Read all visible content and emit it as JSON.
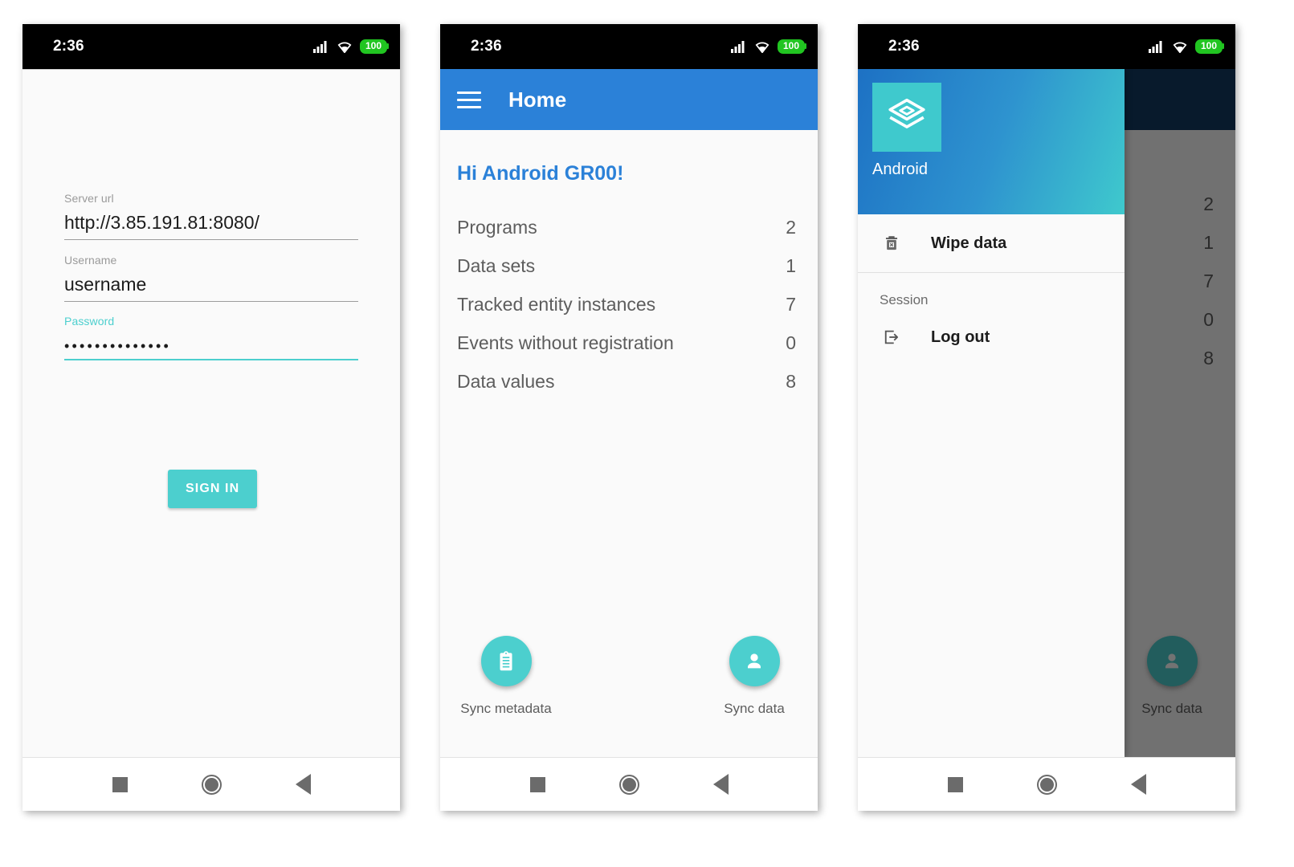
{
  "status_bar": {
    "time": "2:36",
    "battery_level": "100",
    "signal_icon": "cellular-signal-icon",
    "wifi_icon": "wifi-icon",
    "battery_icon": "battery-icon"
  },
  "nav_bar": {
    "recents_icon": "square-recents-icon",
    "home_icon": "circle-home-icon",
    "back_icon": "triangle-back-icon"
  },
  "colors": {
    "accent_teal": "#4ccfce",
    "primary_blue": "#2b81d8",
    "status_bar_black": "#000000",
    "background": "#fafafa",
    "text_secondary": "#5d5d5d",
    "drawer_gradient_start": "#1d71c4",
    "drawer_gradient_end": "#3fc9cd",
    "scrim": "rgba(0,0,0,0.55)",
    "dimmed_fab_teal": "#2a7877"
  },
  "login": {
    "server_url": {
      "label": "Server url",
      "value": "http://3.85.191.81:8080/",
      "focused": false
    },
    "username": {
      "label": "Username",
      "value": "username",
      "focused": false
    },
    "password": {
      "label": "Password",
      "value": "••••••••••••••",
      "focused": true
    },
    "sign_in_label": "SIGN IN"
  },
  "home": {
    "app_bar": {
      "title": "Home",
      "menu_icon": "hamburger-menu-icon"
    },
    "greeting": "Hi Android GR00!",
    "counters": [
      {
        "label": "Programs",
        "value": "2"
      },
      {
        "label": "Data sets",
        "value": "1"
      },
      {
        "label": "Tracked entity instances",
        "value": "7"
      },
      {
        "label": "Events without registration",
        "value": "0"
      },
      {
        "label": "Data values",
        "value": "8"
      }
    ],
    "sync_metadata": {
      "label": "Sync metadata",
      "icon": "clipboard-icon"
    },
    "sync_data": {
      "label": "Sync data",
      "icon": "person-icon"
    }
  },
  "drawer": {
    "logo_icon": "dhis2-layers-logo-icon",
    "username": "Android",
    "items": [
      {
        "label": "Wipe data",
        "icon": "trash-wipe-icon"
      }
    ],
    "section_label": "Session",
    "session_items": [
      {
        "label": "Log out",
        "icon": "logout-arrow-icon"
      }
    ]
  },
  "drawer_screen_background": {
    "counters": [
      {
        "value": "2"
      },
      {
        "value": "1"
      },
      {
        "value": "7"
      },
      {
        "value": "0"
      },
      {
        "value": "8"
      }
    ],
    "sync_data_label": "Sync data",
    "sync_data_icon": "person-icon"
  }
}
